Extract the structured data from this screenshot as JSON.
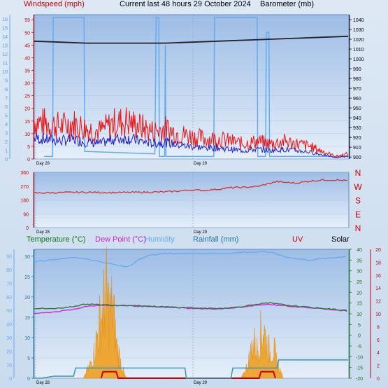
{
  "header": {
    "windspeed_label": "Windspeed (mph)",
    "current_label": "Current last 48 hours 29 October 2024",
    "barometer_label": "Barometer (mb)"
  },
  "lower_header": {
    "temperature_label": "Temperature (°C)",
    "dewpoint_label": "Dew Point (°C)",
    "humidity_label": "Humidity",
    "rainfall_label": "Rainfall (mm)",
    "uv_label": "UV",
    "solar_label": "Solar"
  },
  "colors": {
    "wind": "#ee1111",
    "gust_dark": "#2222cc",
    "humidity": "#66aaee",
    "barometer": "#222222",
    "winddir": "#dd2222",
    "temperature": "#337733",
    "dewpoint": "#dd22dd",
    "rain": "#3399bb",
    "solar": "#f0a020",
    "uv": "#cc0000"
  },
  "chart_data": [
    {
      "type": "line",
      "name": "wind-barometer",
      "day_labels": [
        "Day 28",
        "Day 29"
      ],
      "left_axis_mph": {
        "ticks": [
          0,
          5,
          10,
          15,
          20,
          25,
          30,
          35,
          40,
          45,
          50,
          55
        ],
        "range": [
          0,
          57
        ]
      },
      "left_axis_alt": {
        "ticks": [
          0,
          1,
          2,
          3,
          4,
          5,
          6,
          7,
          8,
          9,
          10,
          11,
          12,
          13,
          14,
          15,
          16
        ],
        "range": [
          0,
          16.5
        ]
      },
      "right_axis_mb": {
        "ticks": [
          900,
          910,
          920,
          930,
          940,
          950,
          960,
          970,
          980,
          990,
          1000,
          1010,
          1020,
          1030,
          1040
        ],
        "range": [
          898,
          1045
        ]
      },
      "series": [
        {
          "name": "Windspeed (mph)",
          "x": [
            0,
            2,
            4,
            6,
            8,
            10,
            12,
            14,
            16,
            18,
            20,
            22,
            24,
            26,
            28,
            30,
            32,
            34,
            36,
            38,
            40,
            42,
            44,
            46,
            47.9
          ],
          "values": [
            15,
            14,
            13,
            14,
            12,
            11,
            14,
            15,
            13,
            11,
            12,
            10,
            9,
            8,
            8,
            7,
            6,
            7,
            6,
            7,
            6,
            5,
            3,
            1,
            2
          ]
        },
        {
          "name": "Barometer (mb)",
          "x": [
            0,
            4,
            8,
            12,
            16,
            20,
            24,
            28,
            32,
            36,
            40,
            44,
            47.9
          ],
          "values": [
            1018,
            1017,
            1016,
            1016,
            1016,
            1016,
            1017,
            1018,
            1019,
            1020,
            1021,
            1022,
            1023
          ]
        }
      ]
    },
    {
      "type": "line",
      "name": "wind-direction",
      "day_labels": [
        "Day 28",
        "Day 29"
      ],
      "left_axis": {
        "ticks": [
          0,
          90,
          180,
          270,
          360
        ],
        "range": [
          0,
          360
        ]
      },
      "compass_labels": [
        "N",
        "W",
        "S",
        "E",
        "N"
      ],
      "series": [
        {
          "name": "Wind direction",
          "x": [
            0,
            4,
            8,
            12,
            16,
            20,
            22,
            24,
            26,
            28,
            30,
            32,
            34,
            36,
            37,
            38,
            40,
            42,
            44,
            46,
            47.9
          ],
          "values": [
            225,
            228,
            230,
            228,
            230,
            232,
            238,
            245,
            242,
            250,
            260,
            262,
            268,
            288,
            300,
            295,
            290,
            302,
            310,
            310,
            305
          ]
        }
      ]
    },
    {
      "type": "line",
      "name": "temperature-rain",
      "day_labels": [
        "Day 28",
        "Day 29"
      ],
      "left_axis_humidity": {
        "ticks": [
          0,
          10,
          20,
          30,
          40,
          50,
          60,
          70,
          80,
          90
        ],
        "range": [
          0,
          95
        ]
      },
      "left_axis_temp": {
        "ticks": [
          0,
          5,
          10,
          15,
          20,
          25,
          30
        ],
        "range": [
          0,
          31.7
        ]
      },
      "right_axis_temp": {
        "ticks": [
          -20,
          -15,
          -10,
          -5,
          0,
          5,
          10,
          15,
          20,
          25,
          30,
          35,
          40
        ],
        "range": [
          -20,
          40
        ]
      },
      "right_axis_uv": {
        "ticks": [
          0,
          2,
          4,
          6,
          8,
          10,
          12,
          14,
          16,
          18,
          20
        ],
        "range": [
          0,
          20
        ]
      },
      "series": [
        {
          "name": "Temperature (°C)",
          "x": [
            0,
            2,
            4,
            6,
            8,
            10,
            12,
            14,
            16,
            18,
            20,
            22,
            24,
            26,
            28,
            30,
            32,
            34,
            36,
            38,
            40,
            42,
            44,
            46,
            47.9
          ],
          "values": [
            12.5,
            12.4,
            12.6,
            13.5,
            14.5,
            14.2,
            14.0,
            14.0,
            13.8,
            13.5,
            13.2,
            13.0,
            12.8,
            12.5,
            12.5,
            12.8,
            13.5,
            14.5,
            15.0,
            14.2,
            13.5,
            13.0,
            12.5,
            12.0,
            11.5
          ]
        },
        {
          "name": "Dew Point (°C)",
          "x": [
            0,
            2,
            4,
            6,
            8,
            10,
            12,
            14,
            16,
            18,
            20,
            22,
            24,
            26,
            28,
            30,
            32,
            34,
            36,
            38,
            40,
            42,
            44,
            46,
            47.9
          ],
          "values": [
            10.2,
            10.5,
            11.2,
            12.0,
            13.5,
            14.0,
            13.8,
            13.8,
            13.5,
            13.2,
            13.0,
            12.8,
            12.5,
            12.3,
            12.3,
            12.6,
            13.2,
            14.0,
            14.3,
            13.8,
            13.2,
            12.8,
            12.3,
            11.8,
            11.2
          ]
        },
        {
          "name": "Humidity",
          "x": [
            0,
            2,
            4,
            6,
            8,
            10,
            12,
            14,
            15,
            16,
            18,
            20,
            22,
            24,
            26,
            28,
            30,
            32,
            34,
            36,
            38,
            40,
            42,
            44,
            46,
            47.9
          ],
          "values": [
            86,
            87,
            88,
            89,
            88,
            86,
            84,
            82,
            84,
            88,
            91,
            92,
            92,
            92,
            92,
            92,
            92,
            93,
            93,
            93,
            90,
            88,
            87,
            88,
            89,
            90
          ]
        },
        {
          "name": "Rainfall (mm)",
          "x": [
            0,
            1,
            3,
            6,
            6.3,
            9,
            12,
            15,
            18,
            22,
            23,
            23.2,
            26,
            29,
            30,
            30.3,
            37,
            37.3,
            40,
            47.9
          ],
          "values": [
            0,
            0,
            0.5,
            0.5,
            2.5,
            2.5,
            2.5,
            2.5,
            2.5,
            2.5,
            2.5,
            0,
            0,
            0,
            0,
            2.5,
            2.5,
            4.5,
            4.5,
            4.5
          ]
        },
        {
          "name": "Solar",
          "x": [
            7.5,
            8,
            8.5,
            9,
            9.5,
            10,
            10.5,
            11,
            11.5,
            12,
            12.5,
            13,
            13.5,
            14,
            31.5,
            32,
            32.5,
            33,
            33.5,
            34,
            34.5,
            35,
            35.5,
            36,
            36.5,
            37,
            37.5,
            38
          ],
          "values": [
            0,
            3,
            6,
            10,
            18,
            26,
            32,
            40,
            30,
            34,
            16,
            10,
            4,
            0,
            0,
            3,
            8,
            16,
            24,
            18,
            28,
            32,
            22,
            16,
            20,
            10,
            5,
            0
          ]
        },
        {
          "name": "UV",
          "x": [
            10.2,
            10.5,
            12.5,
            12.8,
            34.3,
            34.6,
            36.5,
            36.8
          ],
          "values": [
            0,
            1,
            1,
            0,
            0,
            1,
            1,
            0
          ]
        }
      ]
    }
  ]
}
